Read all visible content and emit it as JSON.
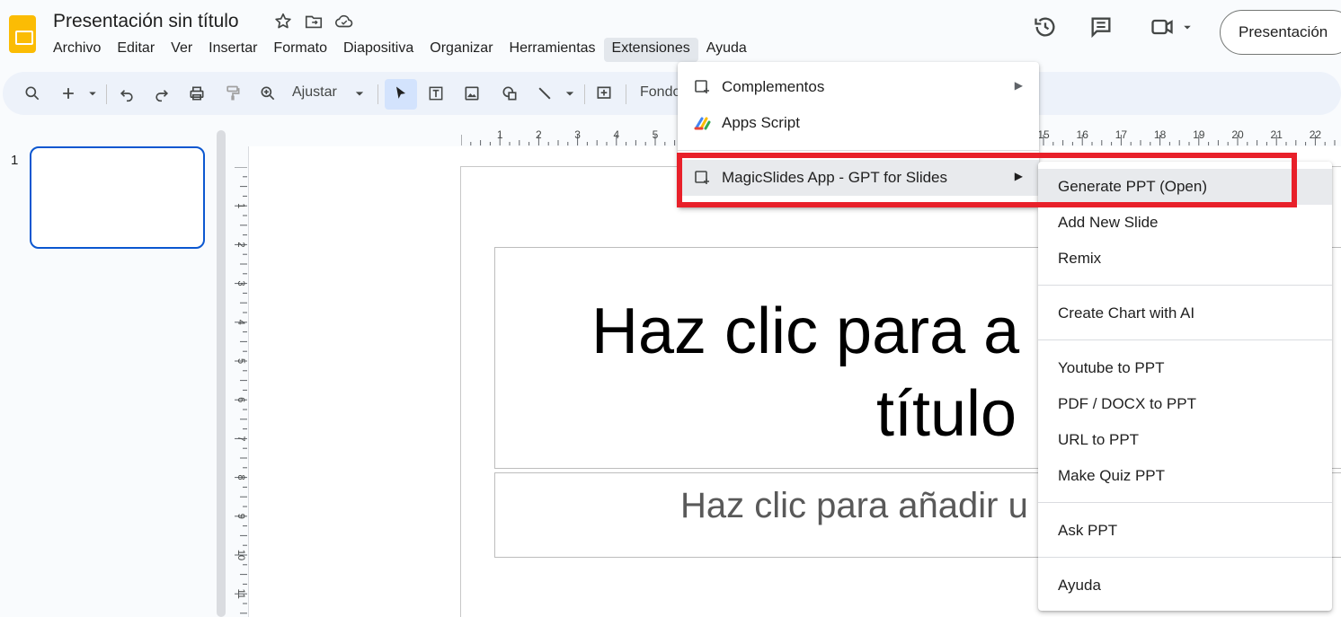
{
  "header": {
    "doc_title": "Presentación sin título",
    "present_label": "Presentación"
  },
  "menubar": [
    "Archivo",
    "Editar",
    "Ver",
    "Insertar",
    "Formato",
    "Diapositiva",
    "Organizar",
    "Herramientas",
    "Extensiones",
    "Ayuda"
  ],
  "toolbar": {
    "zoom_label": "Ajustar",
    "background_label": "Fondo"
  },
  "filmstrip": {
    "slide_number": "1"
  },
  "slide": {
    "title_line1": "Haz clic para a",
    "title_line2": "título",
    "subtitle": "Haz clic para añadir u"
  },
  "rulers": {
    "horizontal": [
      "1",
      "2",
      "3",
      "4",
      "5",
      "15",
      "16",
      "17",
      "18",
      "19",
      "20",
      "21",
      "22"
    ],
    "vertical": [
      "1",
      "2",
      "3",
      "4",
      "5",
      "6",
      "7",
      "8",
      "9",
      "10",
      "11"
    ]
  },
  "extensions_menu": {
    "complementos": "Complementos",
    "apps_script": "Apps Script",
    "magicslides": "MagicSlides App - GPT for Slides"
  },
  "magicslides_submenu": {
    "generate": "Generate PPT (Open)",
    "add_slide": "Add New Slide",
    "remix": "Remix",
    "chart": "Create Chart with AI",
    "youtube": "Youtube to PPT",
    "pdf": "PDF / DOCX to PPT",
    "url": "URL to PPT",
    "quiz": "Make Quiz PPT",
    "ask": "Ask PPT",
    "help": "Ayuda"
  },
  "colors": {
    "highlight_box": "#e8202a",
    "selected_thumb": "#0b57d0",
    "logo": "#fbbc04"
  }
}
